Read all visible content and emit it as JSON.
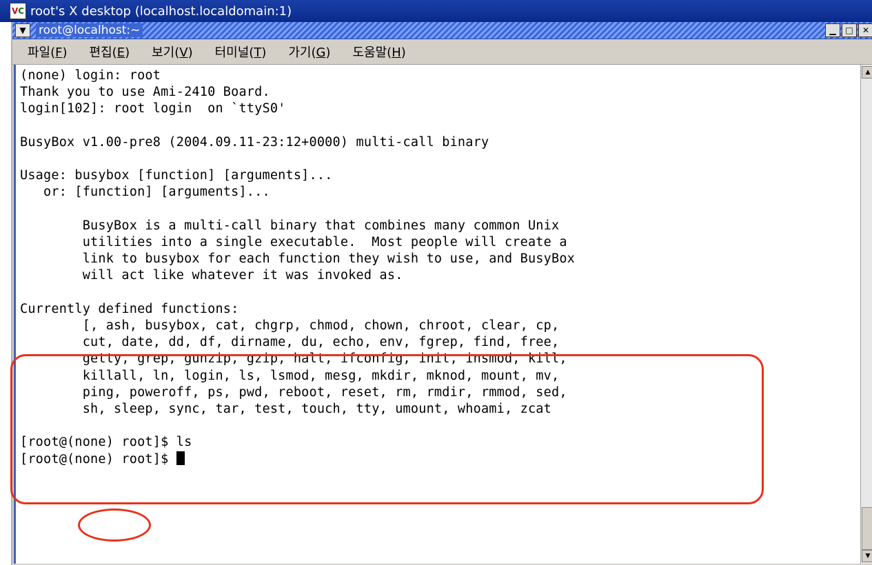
{
  "vnc_window": {
    "logo": "VC",
    "title": "root's X desktop (localhost.localdomain:1)"
  },
  "terminal_window": {
    "title": "root@localhost:~",
    "window_controls": [
      "minimize",
      "maximize",
      "close"
    ],
    "menu": [
      {
        "prefix": "파일(",
        "mnemonic": "F",
        "suffix": ")"
      },
      {
        "prefix": "편집(",
        "mnemonic": "E",
        "suffix": ")"
      },
      {
        "prefix": "보기(",
        "mnemonic": "V",
        "suffix": ")"
      },
      {
        "prefix": "터미널(",
        "mnemonic": "T",
        "suffix": ")"
      },
      {
        "prefix": "가기(",
        "mnemonic": "G",
        "suffix": ")"
      },
      {
        "prefix": "도움말(",
        "mnemonic": "H",
        "suffix": ")"
      }
    ]
  },
  "terminal_output": {
    "lines": [
      "(none) login: root",
      "Thank you to use Ami-2410 Board.",
      "login[102]: root login  on `ttyS0'",
      "",
      "BusyBox v1.00-pre8 (2004.09.11-23:12+0000) multi-call binary",
      "",
      "Usage: busybox [function] [arguments]...",
      "   or: [function] [arguments]...",
      "",
      "        BusyBox is a multi-call binary that combines many common Unix",
      "        utilities into a single executable.  Most people will create a",
      "        link to busybox for each function they wish to use, and BusyBox",
      "        will act like whatever it was invoked as.",
      "",
      "Currently defined functions:",
      "        [, ash, busybox, cat, chgrp, chmod, chown, chroot, clear, cp,",
      "        cut, date, dd, df, dirname, du, echo, env, fgrep, find, free,",
      "        getty, grep, gunzip, gzip, halt, ifconfig, init, insmod, kill,",
      "        killall, ln, login, ls, lsmod, mesg, mkdir, mknod, mount, mv,",
      "        ping, poweroff, ps, pwd, reboot, reset, rm, rmdir, rmmod, sed,",
      "        sh, sleep, sync, tar, test, touch, tty, umount, whoami, zcat",
      "",
      "[root@(none) root]$ ls"
    ],
    "prompt": "[root@(none) root]$ "
  },
  "annotations": {
    "highlight_color": "#e8321a",
    "highlighted": [
      "currently-defined-functions-block",
      "hostname-none"
    ]
  },
  "colors": {
    "vnc_titlebar": "#0a2a8a",
    "terminal_titlebar": "#3c66d6",
    "terminal_bg": "#ffffff",
    "terminal_fg": "#000000"
  }
}
